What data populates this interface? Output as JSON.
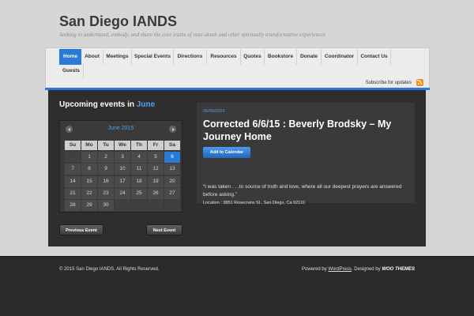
{
  "site": {
    "title": "San Diego IANDS",
    "tagline": "Seeking to understand, embody, and share the core truths of near-death and other spiritually transformative experiences"
  },
  "nav": {
    "items": [
      "Home",
      "About",
      "Meetings",
      "Special Events",
      "Directions",
      "Resources",
      "Quotes",
      "Bookstore",
      "Donate",
      "Coordinator",
      "Contact Us",
      "Guests"
    ],
    "active": "Home",
    "subscribe": "Subscribe for updates"
  },
  "upcoming": {
    "prefix": "Upcoming events in",
    "month": "June"
  },
  "calendar": {
    "month_label": "June 2015",
    "weekdays": [
      "Su",
      "Mo",
      "Tu",
      "We",
      "Th",
      "Fr",
      "Sa"
    ],
    "weeks": [
      [
        "",
        "1",
        "2",
        "3",
        "4",
        "5",
        "6"
      ],
      [
        "7",
        "8",
        "9",
        "10",
        "11",
        "12",
        "13"
      ],
      [
        "14",
        "15",
        "16",
        "17",
        "18",
        "19",
        "20"
      ],
      [
        "21",
        "22",
        "23",
        "24",
        "25",
        "26",
        "27"
      ],
      [
        "28",
        "29",
        "30",
        "",
        "",
        "",
        ""
      ]
    ],
    "selected": "6",
    "prev_label": "Previous Event",
    "next_label": "Next Event"
  },
  "event": {
    "date": "06/06/2015",
    "title": "Corrected 6/6/15 : Beverly Brodsky – My Journey Home",
    "add_label": "Add to Calendar",
    "quote": "“I was taken . . .to source of truth and love, where all our deepest prayers are answered before asking.”",
    "location": "Location : 3851 Rosecrans St., San Diego, Ca 92110"
  },
  "footer": {
    "copyright": "© 2015 San Diego IANDS. All Rights Reserved.",
    "powered_prefix": "Powered by",
    "powered_link": "WordPress",
    "designed_by": ". Designed by",
    "designer": "WOO THEMES"
  },
  "colors": {
    "accent": "#2b7bd6",
    "background": "#d6d6d6",
    "panel": "#2e2e2e"
  }
}
